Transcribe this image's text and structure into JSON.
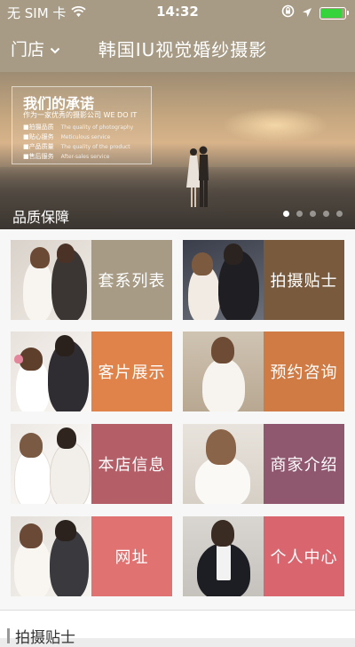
{
  "status_bar": {
    "carrier": "无 SIM 卡",
    "time": "14:32",
    "battery_level": 0.9,
    "icons": [
      "wifi-icon",
      "rotation-lock-icon",
      "location-arrow-icon",
      "battery-icon"
    ]
  },
  "nav": {
    "store_label": "门店",
    "title": "韩国IU视觉婚纱摄影"
  },
  "banner": {
    "promise_title": "我们的承诺",
    "promise_subtitle": "作为一家优秀的摄影公司 WE DO IT",
    "promise_items": [
      {
        "label": "■拍摄品质",
        "en": "The quality of photography"
      },
      {
        "label": "■贴心服务",
        "en": "Meticulous service"
      },
      {
        "label": "■产品质量",
        "en": "The quality of the product"
      },
      {
        "label": "■售后服务",
        "en": "After-sales service"
      }
    ],
    "caption": "品质保障",
    "slide_count": 5,
    "active_slide": 1
  },
  "menu": {
    "tiles": [
      {
        "label": "套系列表",
        "color": "#a79b86"
      },
      {
        "label": "拍摄贴士",
        "color": "#7a5a3c"
      },
      {
        "label": "客片展示",
        "color": "#e0834a"
      },
      {
        "label": "预约咨询",
        "color": "#d07a44"
      },
      {
        "label": "本店信息",
        "color": "#b45f68"
      },
      {
        "label": "商家介绍",
        "color": "#8f586f"
      },
      {
        "label": "网址",
        "color": "#e07272"
      },
      {
        "label": "个人中心",
        "color": "#d9666f"
      }
    ]
  },
  "section": {
    "title": "拍摄贴士"
  }
}
